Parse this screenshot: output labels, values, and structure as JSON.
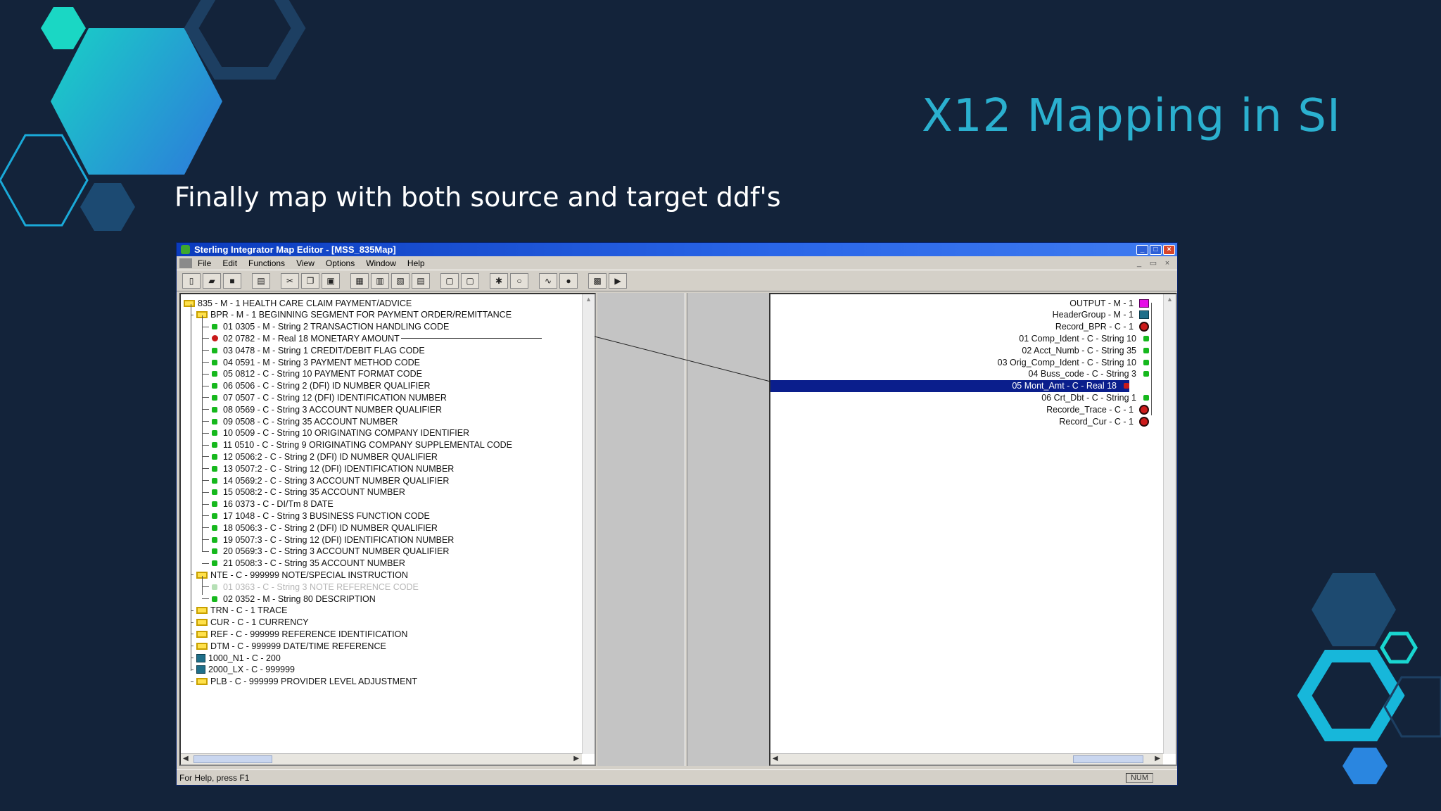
{
  "slide": {
    "title": "X12 Mapping in SI",
    "subtitle": "Finally map with both source and target ddf's"
  },
  "window": {
    "title": "Sterling Integrator Map Editor - [MSS_835Map]",
    "menu": [
      "File",
      "Edit",
      "Functions",
      "View",
      "Options",
      "Window",
      "Help"
    ],
    "status_text": "For Help, press F1",
    "num_indicator": "NUM"
  },
  "source_tree": [
    {
      "text": "835 - M - 1 HEALTH CARE CLAIM PAYMENT/ADVICE",
      "kind": "root",
      "level": 0
    },
    {
      "text": "BPR - M - 1 BEGINNING SEGMENT FOR PAYMENT ORDER/REMITTANCE",
      "kind": "segment",
      "level": 1
    },
    {
      "text": "01 0305 - M - String 2 TRANSACTION HANDLING CODE",
      "kind": "field",
      "level": 2
    },
    {
      "text": "02 0782 - M - Real 18 MONETARY AMOUNT",
      "kind": "linked",
      "level": 2
    },
    {
      "text": "03 0478 - M - String 1 CREDIT/DEBIT FLAG CODE",
      "kind": "field",
      "level": 2
    },
    {
      "text": "04 0591 - M - String 3 PAYMENT METHOD CODE",
      "kind": "field",
      "level": 2
    },
    {
      "text": "05 0812 - C - String 10 PAYMENT FORMAT CODE",
      "kind": "field",
      "level": 2
    },
    {
      "text": "06 0506 - C - String 2 (DFI) ID NUMBER QUALIFIER",
      "kind": "field",
      "level": 2
    },
    {
      "text": "07 0507 - C - String 12 (DFI) IDENTIFICATION NUMBER",
      "kind": "field",
      "level": 2
    },
    {
      "text": "08 0569 - C - String 3 ACCOUNT NUMBER QUALIFIER",
      "kind": "field",
      "level": 2
    },
    {
      "text": "09 0508 - C - String 35 ACCOUNT NUMBER",
      "kind": "field",
      "level": 2
    },
    {
      "text": "10 0509 - C - String 10 ORIGINATING COMPANY IDENTIFIER",
      "kind": "field",
      "level": 2
    },
    {
      "text": "11 0510 - C - String 9 ORIGINATING COMPANY SUPPLEMENTAL CODE",
      "kind": "field",
      "level": 2
    },
    {
      "text": "12 0506:2 - C - String 2 (DFI) ID NUMBER QUALIFIER",
      "kind": "field",
      "level": 2
    },
    {
      "text": "13 0507:2 - C - String 12 (DFI) IDENTIFICATION NUMBER",
      "kind": "field",
      "level": 2
    },
    {
      "text": "14 0569:2 - C - String 3 ACCOUNT NUMBER QUALIFIER",
      "kind": "field",
      "level": 2
    },
    {
      "text": "15 0508:2 - C - String 35 ACCOUNT NUMBER",
      "kind": "field",
      "level": 2
    },
    {
      "text": "16 0373 - C - DI/Tm 8 DATE",
      "kind": "field",
      "level": 2
    },
    {
      "text": "17 1048 - C - String 3 BUSINESS FUNCTION CODE",
      "kind": "field",
      "level": 2
    },
    {
      "text": "18 0506:3 - C - String 2 (DFI) ID NUMBER QUALIFIER",
      "kind": "field",
      "level": 2
    },
    {
      "text": "19 0507:3 - C - String 12 (DFI) IDENTIFICATION NUMBER",
      "kind": "field",
      "level": 2
    },
    {
      "text": "20 0569:3 - C - String 3 ACCOUNT NUMBER QUALIFIER",
      "kind": "field",
      "level": 2
    },
    {
      "text": "21 0508:3 - C - String 35 ACCOUNT NUMBER",
      "kind": "field",
      "level": 2
    },
    {
      "text": "NTE - C - 999999 NOTE/SPECIAL INSTRUCTION",
      "kind": "segment",
      "level": 1
    },
    {
      "text": "01 0363 - C - String 3 NOTE REFERENCE CODE",
      "kind": "disabled",
      "level": 2
    },
    {
      "text": "02 0352 - M - String 80 DESCRIPTION",
      "kind": "field",
      "level": 2
    },
    {
      "text": "TRN - C - 1 TRACE",
      "kind": "segment",
      "level": 1
    },
    {
      "text": "CUR - C - 1 CURRENCY",
      "kind": "segment",
      "level": 1
    },
    {
      "text": "REF - C - 999999 REFERENCE IDENTIFICATION",
      "kind": "segment",
      "level": 1
    },
    {
      "text": "DTM - C - 999999 DATE/TIME REFERENCE",
      "kind": "segment",
      "level": 1
    },
    {
      "text": "1000_N1 - C - 200",
      "kind": "group",
      "level": 1
    },
    {
      "text": "2000_LX - C - 999999",
      "kind": "group",
      "level": 1
    },
    {
      "text": "PLB - C - 999999 PROVIDER LEVEL ADJUSTMENT",
      "kind": "segment",
      "level": 1
    }
  ],
  "output_tree": [
    {
      "text": "OUTPUT - M - 1",
      "kind": "top"
    },
    {
      "text": "HeaderGroup - M - 1",
      "kind": "group"
    },
    {
      "text": "Record_BPR - C - 1",
      "kind": "record"
    },
    {
      "text": "01 Comp_Ident - C - String 10",
      "kind": "field"
    },
    {
      "text": "02 Acct_Numb - C - String 35",
      "kind": "field"
    },
    {
      "text": "03 Orig_Comp_Ident - C - String 10",
      "kind": "field"
    },
    {
      "text": "04 Buss_code - C - String 3",
      "kind": "field"
    },
    {
      "text": "05 Mont_Amt - C - Real 18",
      "kind": "selected"
    },
    {
      "text": "06 Crt_Dbt - C - String 1",
      "kind": "field"
    },
    {
      "text": "Recorde_Trace - C - 1",
      "kind": "record"
    },
    {
      "text": "Record_Cur - C - 1",
      "kind": "record"
    }
  ]
}
